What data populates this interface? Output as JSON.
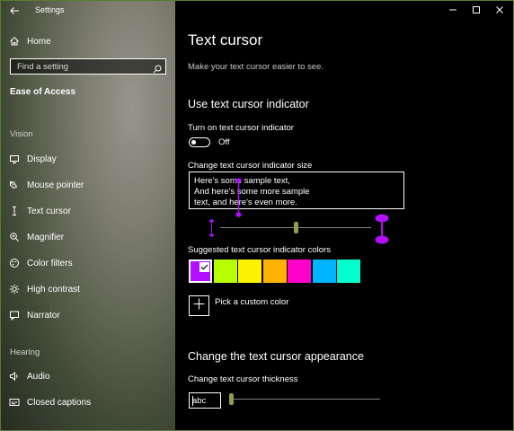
{
  "window": {
    "app_title": "Settings",
    "minimize_icon": "minimize-icon",
    "maximize_icon": "maximize-icon",
    "close_icon": "close-icon"
  },
  "sidebar": {
    "home_label": "Home",
    "search_placeholder": "Find a setting",
    "section_title": "Ease of Access",
    "groups": [
      {
        "header": "Vision",
        "items": [
          {
            "label": "Display",
            "icon": "display-icon"
          },
          {
            "label": "Mouse pointer",
            "icon": "mouse-pointer-icon"
          },
          {
            "label": "Text cursor",
            "icon": "text-cursor-icon"
          },
          {
            "label": "Magnifier",
            "icon": "magnifier-icon"
          },
          {
            "label": "Color filters",
            "icon": "color-filters-icon"
          },
          {
            "label": "High contrast",
            "icon": "high-contrast-icon"
          },
          {
            "label": "Narrator",
            "icon": "narrator-icon"
          }
        ]
      },
      {
        "header": "Hearing",
        "items": [
          {
            "label": "Audio",
            "icon": "audio-icon"
          },
          {
            "label": "Closed captions",
            "icon": "closed-captions-icon"
          }
        ]
      }
    ]
  },
  "main": {
    "title": "Text cursor",
    "subtitle": "Make your text cursor easier to see.",
    "indicator_section": {
      "heading": "Use text cursor indicator",
      "toggle_label": "Turn on text cursor indicator",
      "toggle_state": "Off",
      "size_label": "Change text cursor indicator size",
      "sample_lines": [
        "Here's some sample text,",
        "And here's some more sample",
        "text, and here's even more."
      ],
      "size_level": 0.5,
      "colors_label": "Suggested text cursor indicator colors",
      "colors": [
        "#b40fff",
        "#b7ff00",
        "#fff200",
        "#ffb300",
        "#ff00cc",
        "#00b4ff",
        "#00ffcc"
      ],
      "selected_color_index": 0,
      "custom_color_label": "Pick a custom color"
    },
    "appearance_section": {
      "heading": "Change the text cursor appearance",
      "thickness_label": "Change text cursor thickness",
      "preview_text": "abc",
      "thickness_level": 0
    }
  }
}
